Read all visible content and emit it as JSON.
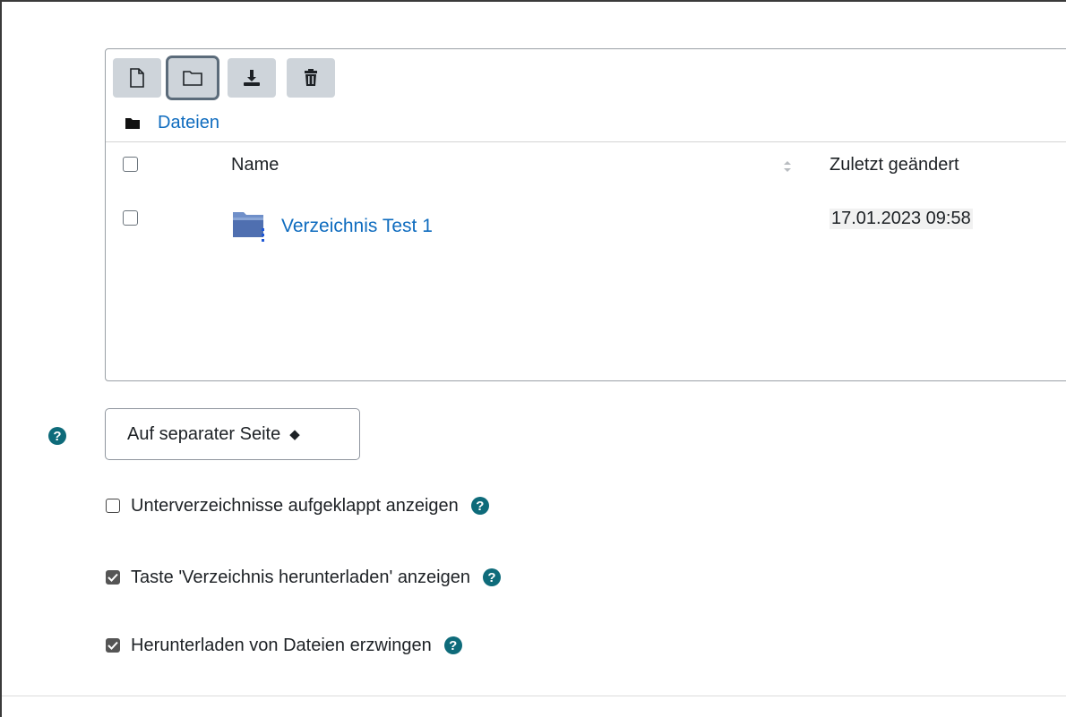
{
  "file_manager": {
    "toolbar": {
      "buttons": [
        {
          "name": "add-file",
          "icon": "file-icon"
        },
        {
          "name": "create-folder",
          "icon": "folder-icon",
          "active": true
        },
        {
          "name": "download",
          "icon": "download-icon"
        },
        {
          "name": "delete",
          "icon": "trash-icon"
        }
      ]
    },
    "breadcrumb": {
      "label": "Dateien",
      "icon": "folder-solid-icon"
    },
    "columns": {
      "name": "Name",
      "modified": "Zuletzt geändert"
    },
    "rows": [
      {
        "name": "Verzeichnis Test 1",
        "modified": "17.01.2023 09:58",
        "checked": false,
        "icon": "folder-icon"
      }
    ]
  },
  "display": {
    "select_value": "Auf separater Seite",
    "help_icon": "question-circle-icon"
  },
  "options": [
    {
      "label": "Unterverzeichnisse aufgeklappt anzeigen",
      "checked": false
    },
    {
      "label": "Taste 'Verzeichnis herunterladen' anzeigen",
      "checked": true
    },
    {
      "label": "Herunterladen von Dateien erzwingen",
      "checked": true
    }
  ],
  "colors": {
    "link": "#0f6cbf",
    "help": "#0e6b7a",
    "button": "#ced4da"
  }
}
